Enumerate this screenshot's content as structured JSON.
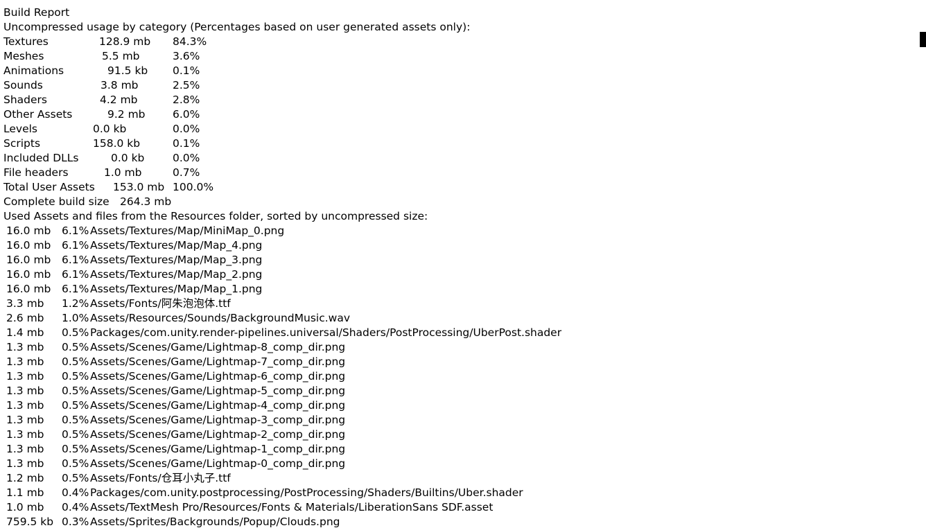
{
  "report": {
    "title": "Build Report",
    "categories_heading": "Uncompressed usage by category (Percentages based on user generated assets only):",
    "categories": [
      {
        "name": "Textures",
        "size": "128.9 mb",
        "percent": "84.3%"
      },
      {
        "name": "Meshes",
        "size": "5.5 mb",
        "percent": "3.6%"
      },
      {
        "name": "Animations",
        "size": "91.5 kb",
        "percent": "0.1%"
      },
      {
        "name": "Sounds",
        "size": "3.8 mb",
        "percent": "2.5%"
      },
      {
        "name": "Shaders",
        "size": "4.2 mb",
        "percent": "2.8%"
      },
      {
        "name": "Other Assets",
        "size": "9.2 mb",
        "percent": "6.0%"
      },
      {
        "name": "Levels",
        "size": "0.0 kb",
        "percent": "0.0%"
      },
      {
        "name": "Scripts",
        "size": "158.0 kb",
        "percent": "0.1%"
      },
      {
        "name": "Included DLLs",
        "size": "0.0 kb",
        "percent": "0.0%"
      },
      {
        "name": "File headers",
        "size": "1.0 mb",
        "percent": "0.7%"
      },
      {
        "name": "Total User Assets",
        "size": "153.0 mb",
        "percent": "100.0%"
      }
    ],
    "complete_build": {
      "label": "Complete build size",
      "size": "264.3 mb"
    },
    "assets_heading": "Used Assets and files from the Resources folder, sorted by uncompressed size:",
    "assets": [
      {
        "size": "16.0 mb",
        "percent": "6.1%",
        "path": "Assets/Textures/Map/MiniMap_0.png"
      },
      {
        "size": "16.0 mb",
        "percent": "6.1%",
        "path": "Assets/Textures/Map/Map_4.png"
      },
      {
        "size": "16.0 mb",
        "percent": "6.1%",
        "path": "Assets/Textures/Map/Map_3.png"
      },
      {
        "size": "16.0 mb",
        "percent": "6.1%",
        "path": "Assets/Textures/Map/Map_2.png"
      },
      {
        "size": "16.0 mb",
        "percent": "6.1%",
        "path": "Assets/Textures/Map/Map_1.png"
      },
      {
        "size": "3.3 mb",
        "percent": "1.2%",
        "path": "Assets/Fonts/阿朱泡泡体.ttf"
      },
      {
        "size": "2.6 mb",
        "percent": "1.0%",
        "path": "Assets/Resources/Sounds/BackgroundMusic.wav"
      },
      {
        "size": "1.4 mb",
        "percent": "0.5%",
        "path": "Packages/com.unity.render-pipelines.universal/Shaders/PostProcessing/UberPost.shader"
      },
      {
        "size": "1.3 mb",
        "percent": "0.5%",
        "path": "Assets/Scenes/Game/Lightmap-8_comp_dir.png"
      },
      {
        "size": "1.3 mb",
        "percent": "0.5%",
        "path": "Assets/Scenes/Game/Lightmap-7_comp_dir.png"
      },
      {
        "size": "1.3 mb",
        "percent": "0.5%",
        "path": "Assets/Scenes/Game/Lightmap-6_comp_dir.png"
      },
      {
        "size": "1.3 mb",
        "percent": "0.5%",
        "path": "Assets/Scenes/Game/Lightmap-5_comp_dir.png"
      },
      {
        "size": "1.3 mb",
        "percent": "0.5%",
        "path": "Assets/Scenes/Game/Lightmap-4_comp_dir.png"
      },
      {
        "size": "1.3 mb",
        "percent": "0.5%",
        "path": "Assets/Scenes/Game/Lightmap-3_comp_dir.png"
      },
      {
        "size": "1.3 mb",
        "percent": "0.5%",
        "path": "Assets/Scenes/Game/Lightmap-2_comp_dir.png"
      },
      {
        "size": "1.3 mb",
        "percent": "0.5%",
        "path": "Assets/Scenes/Game/Lightmap-1_comp_dir.png"
      },
      {
        "size": "1.3 mb",
        "percent": "0.5%",
        "path": "Assets/Scenes/Game/Lightmap-0_comp_dir.png"
      },
      {
        "size": "1.2 mb",
        "percent": "0.5%",
        "path": "Assets/Fonts/仓耳小丸子.ttf"
      },
      {
        "size": "1.1 mb",
        "percent": "0.4%",
        "path": "Packages/com.unity.postprocessing/PostProcessing/Shaders/Builtins/Uber.shader"
      },
      {
        "size": "1.0 mb",
        "percent": "0.4%",
        "path": "Assets/TextMesh Pro/Resources/Fonts & Materials/LiberationSans SDF.asset"
      },
      {
        "size": "759.5 kb",
        "percent": "0.3%",
        "path": "Assets/Sprites/Backgrounds/Popup/Clouds.png"
      }
    ]
  }
}
